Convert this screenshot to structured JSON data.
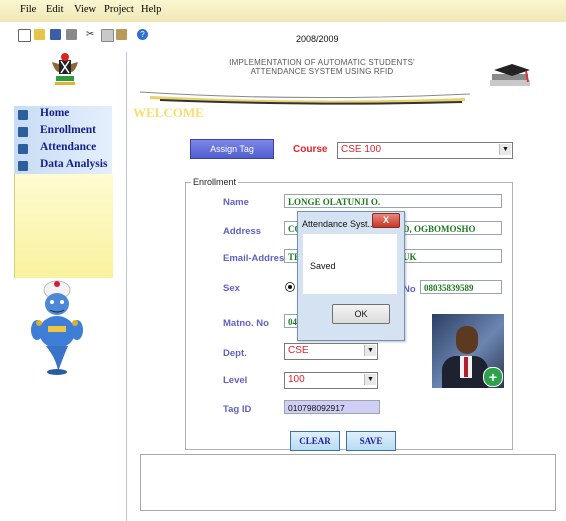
{
  "menu": [
    "File",
    "Edit",
    "View",
    "Project",
    "Help"
  ],
  "toolbar": {
    "icons": [
      "new-file-icon",
      "open-folder-icon",
      "save-icon",
      "print-icon",
      "cut-icon",
      "copy-icon",
      "paste-icon",
      "help-icon"
    ],
    "session": "2008/2009"
  },
  "sidebar": {
    "items": [
      {
        "label": "Home"
      },
      {
        "label": "Enrollment"
      },
      {
        "label": "Attendance"
      },
      {
        "label": "Data Analysis"
      }
    ]
  },
  "header": {
    "title_line1": "IMPLEMENTATION OF AUTOMATIC STUDENTS'",
    "title_line2": "ATTENDANCE SYSTEM USING RFID",
    "welcome": "WELCOME"
  },
  "assign_tag": "Assign Tag",
  "course": {
    "label": "Course",
    "value": "CSE 100"
  },
  "enrollment": {
    "legend": "Enrollment",
    "name_label": "Name",
    "name_value": "LONGE OLATUNJI O.",
    "address_label": "Address",
    "address_value_left": "CO",
    "address_value_right": "D, OGBOMOSHO",
    "email_label": "Email-Address",
    "email_value_left": "TE",
    "email_value_right": "UK",
    "sex_label": "Sex",
    "phone_label_suffix": "No",
    "phone_value": "08035839589",
    "matno_label": "Matno. No",
    "matno_value": "04",
    "dept_label": "Dept.",
    "dept_value": "CSE",
    "level_label": "Level",
    "level_value": "100",
    "tagid_label": "Tag ID",
    "tagid_value": "010798092917"
  },
  "buttons": {
    "clear": "CLEAR",
    "save": "SAVE"
  },
  "dialog": {
    "title": "Attendance Syst...",
    "close": "X",
    "message": "Saved",
    "ok": "OK"
  }
}
